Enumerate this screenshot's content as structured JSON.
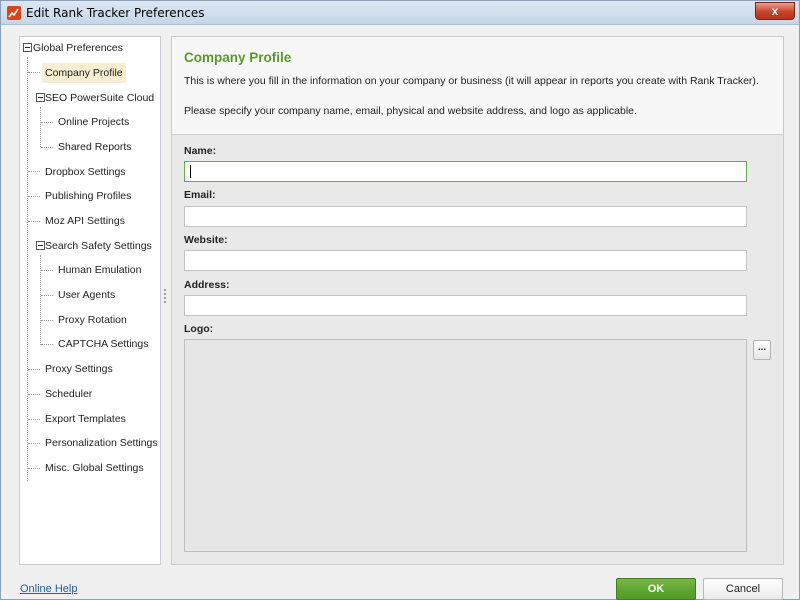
{
  "window": {
    "title": "Edit Rank Tracker Preferences",
    "close_label": "x",
    "app_icon": "rank-tracker-icon"
  },
  "sidebar": {
    "items": [
      {
        "label": "Global Preferences",
        "level": 0,
        "expandable": true
      },
      {
        "label": "Company Profile",
        "level": 1,
        "selected": true
      },
      {
        "label": "SEO PowerSuite Cloud",
        "level": 1,
        "expandable": true
      },
      {
        "label": "Online Projects",
        "level": 2
      },
      {
        "label": "Shared Reports",
        "level": 2
      },
      {
        "label": "Dropbox Settings",
        "level": 1
      },
      {
        "label": "Publishing Profiles",
        "level": 1
      },
      {
        "label": "Moz API Settings",
        "level": 1
      },
      {
        "label": "Search Safety Settings",
        "level": 1,
        "expandable": true
      },
      {
        "label": "Human Emulation",
        "level": 2
      },
      {
        "label": "User Agents",
        "level": 2
      },
      {
        "label": "Proxy Rotation",
        "level": 2
      },
      {
        "label": "CAPTCHA Settings",
        "level": 2
      },
      {
        "label": "Proxy Settings",
        "level": 1
      },
      {
        "label": "Scheduler",
        "level": 1
      },
      {
        "label": "Export Templates",
        "level": 1
      },
      {
        "label": "Personalization Settings",
        "level": 1
      },
      {
        "label": "Misc. Global Settings",
        "level": 1
      }
    ]
  },
  "main": {
    "title": "Company Profile",
    "description_1": "This is where you fill in the information on your company or business (it will appear in reports you create with Rank Tracker).",
    "description_2": "Please specify your company name, email, physical and website address, and logo as applicable.",
    "fields": {
      "name": {
        "label": "Name:",
        "value": ""
      },
      "email": {
        "label": "Email:",
        "value": ""
      },
      "website": {
        "label": "Website:",
        "value": ""
      },
      "address": {
        "label": "Address:",
        "value": ""
      },
      "logo": {
        "label": "Logo:"
      }
    },
    "browse_label": "..."
  },
  "footer": {
    "help_link": "Online Help",
    "ok_label": "OK",
    "cancel_label": "Cancel"
  },
  "colors": {
    "accent_green": "#5a9a2a",
    "ok_button": "#5ea830",
    "selection": "#f7edd0",
    "link_blue": "#1f5fa8"
  }
}
